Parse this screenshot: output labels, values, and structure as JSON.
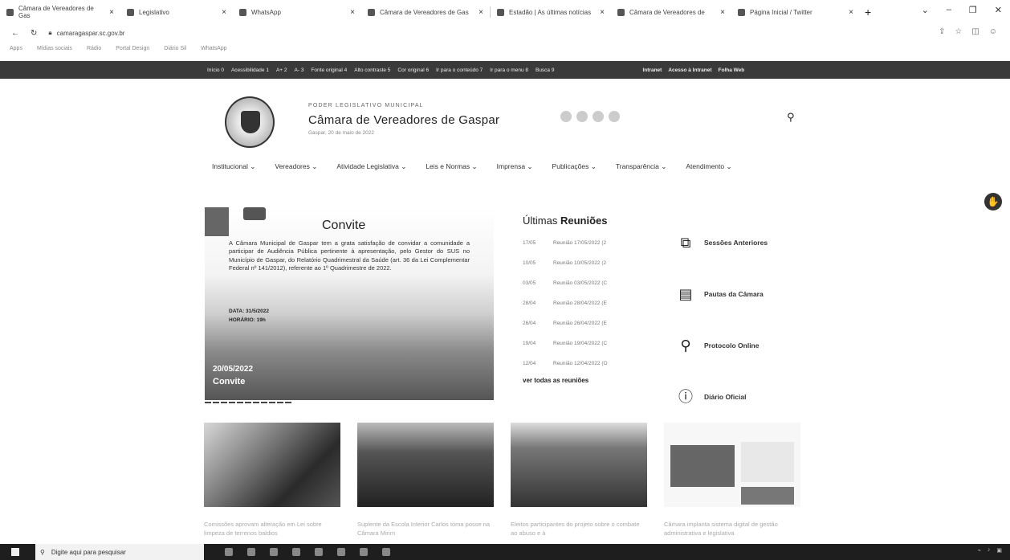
{
  "browser": {
    "tabs": [
      {
        "title": "Câmara de Vereadores de Gas"
      },
      {
        "title": "Legislativo"
      },
      {
        "title": "WhatsApp"
      },
      {
        "title": "Câmara de Vereadores de Gas"
      },
      {
        "title": "Estadão | As últimas notícias"
      },
      {
        "title": "Câmara de Vereadores de"
      },
      {
        "title": "Página Inicial / Twitter"
      }
    ],
    "url": "camaragaspar.sc.gov.br",
    "bookmarks": [
      "Apps",
      "Mídias sociais",
      "Rádio",
      "Portal Design",
      "Diário Sil",
      "WhatsApp"
    ]
  },
  "accessibility_bar": {
    "left": [
      "Início 0",
      "Acessibilidade 1",
      "A+ 2",
      "A- 3",
      "Fonte original 4",
      "Alto contraste 5",
      "Cor original 6",
      "Ir para o conteúdo 7",
      "Ir para o menu 8",
      "Busca 9"
    ],
    "right": [
      "Intranet",
      "Acesso à Intranet",
      "Folha Web"
    ]
  },
  "header": {
    "kicker": "PODER LEGISLATIVO MUNICIPAL",
    "title": "Câmara de Vereadores de Gaspar",
    "date": "Gaspar, 20 de maio de 2022"
  },
  "nav": [
    "Institucional",
    "Vereadores",
    "Atividade Legislativa",
    "Leis e Normas",
    "Imprensa",
    "Publicações",
    "Transparência",
    "Atendimento"
  ],
  "feature": {
    "title": "Convite",
    "body": "A Câmara Municipal de Gaspar tem a grata satisfação de convidar a comunidade a participar de Audiência Pública pertinente à apresentação, pelo Gestor do SUS no Município de Gaspar, do Relatório Quadrimestral da Saúde (art. 36 da Lei Complementar Federal nº 141/2012), referente ao 1º Quadrimestre de 2022.",
    "data_label": "DATA: 31/5/2022",
    "hora_label": "HORÁRIO: 19h",
    "date": "20/05/2022",
    "caption": "Convite"
  },
  "meetings": {
    "title_light": "Últimas",
    "title_bold": "Reuniões",
    "items": [
      {
        "date": "17/05",
        "text": "Reunião 17/05/2022 (2"
      },
      {
        "date": "10/05",
        "text": "Reunião 10/05/2022 (2"
      },
      {
        "date": "03/05",
        "text": "Reunião 03/05/2022 (C"
      },
      {
        "date": "28/04",
        "text": "Reunião 28/04/2022 (E"
      },
      {
        "date": "26/04",
        "text": "Reunião 26/04/2022 (E"
      },
      {
        "date": "19/04",
        "text": "Reunião 19/04/2022 (C"
      },
      {
        "date": "12/04",
        "text": "Reunião 12/04/2022 (O"
      }
    ],
    "ver_todas": "ver todas as reuniões"
  },
  "quick_links": [
    {
      "label": "Sessões Anteriores",
      "icon": "sessions-icon"
    },
    {
      "label": "Pautas da Câmara",
      "icon": "document-icon"
    },
    {
      "label": "Protocolo Online",
      "icon": "search-icon"
    },
    {
      "label": "Diário Oficial",
      "icon": "diary-icon"
    }
  ],
  "news": [
    {
      "text": "Comissões aprovam alteração em Lei sobre limpeza de terrenos baldios"
    },
    {
      "text": "Suplente da Escola Interior Carlos toma posse na Câmara Mirim"
    },
    {
      "text": "Eleitos participantes do projeto sobre o combate ao abuso e à"
    },
    {
      "text": "Câmara implanta sistema digital de gestão administrativa e legislativa"
    }
  ],
  "taskbar": {
    "search_placeholder": "Digite aqui para pesquisar"
  }
}
